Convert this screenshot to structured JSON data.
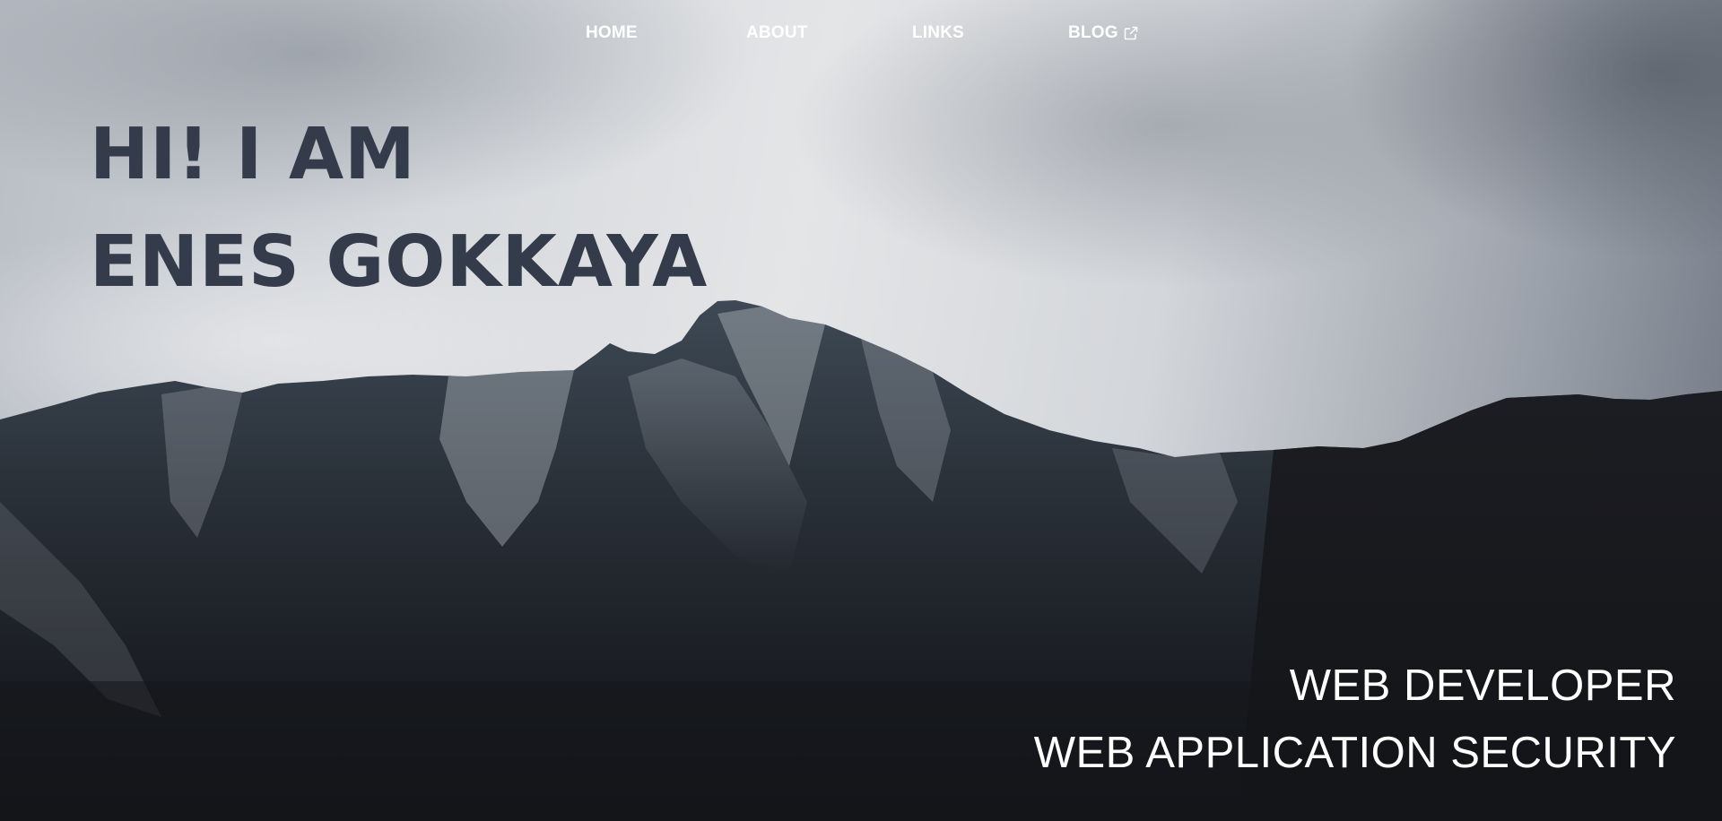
{
  "nav": {
    "items": [
      {
        "label": "HOME"
      },
      {
        "label": "ABOUT"
      },
      {
        "label": "LINKS"
      },
      {
        "label": "BLOG",
        "icon": "external-link-icon"
      }
    ]
  },
  "hero": {
    "headline_line1": "HI! I AM",
    "headline_line2": "ENES GOKKAYA",
    "tagline_line1": "WEB DEVELOPER",
    "tagline_line2": "WEB APPLICATION SECURITY"
  },
  "colors": {
    "headline": "#343b4a",
    "nav_text": "#ffffff",
    "tagline": "#ffffff",
    "mountain_dark": "#17181c"
  }
}
